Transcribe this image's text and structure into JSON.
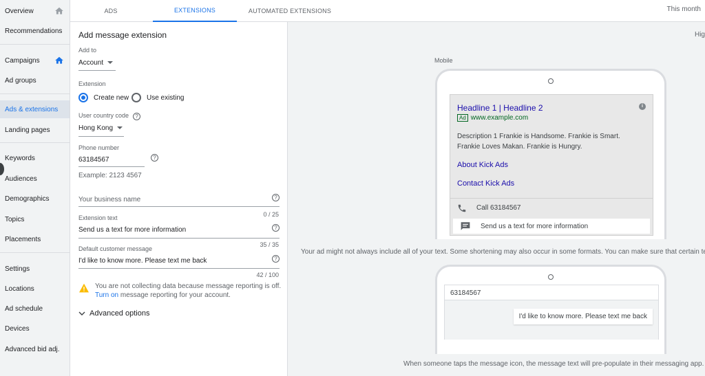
{
  "sidebar": {
    "items": [
      {
        "label": "Overview"
      },
      {
        "label": "Recommendations"
      },
      {
        "label": "Campaigns"
      },
      {
        "label": "Ad groups"
      },
      {
        "label": "Ads & extensions"
      },
      {
        "label": "Landing pages"
      },
      {
        "label": "Keywords"
      },
      {
        "label": "Audiences"
      },
      {
        "label": "Demographics"
      },
      {
        "label": "Topics"
      },
      {
        "label": "Placements"
      },
      {
        "label": "Settings"
      },
      {
        "label": "Locations"
      },
      {
        "label": "Ad schedule"
      },
      {
        "label": "Devices"
      },
      {
        "label": "Advanced bid adj."
      }
    ],
    "active_index": 4
  },
  "tabs": [
    {
      "label": "ADS"
    },
    {
      "label": "EXTENSIONS"
    },
    {
      "label": "AUTOMATED EXTENSIONS"
    }
  ],
  "date_range": "This month",
  "form": {
    "title": "Add message extension",
    "add_to_label": "Add to",
    "add_to_value": "Account",
    "extension_label": "Extension",
    "radio_create": "Create new",
    "radio_existing": "Use existing",
    "country_label": "User country code",
    "country_value": "Hong Kong",
    "phone_label": "Phone number",
    "phone_value": "63184567",
    "phone_example": "Example: 2123 4567",
    "business_placeholder": "Your business name",
    "business_counter": "0 / 25",
    "ext_text_label": "Extension text",
    "ext_text_value": "Send us a text for more information",
    "ext_text_counter": "35 / 35",
    "default_msg_label": "Default customer message",
    "default_msg_value": "I'd like to know more. Please text me back",
    "default_msg_counter": "42 / 100",
    "warning_line1": "You are not collecting data because message reporting is off.",
    "warning_link": "Turn on",
    "warning_line2": "message reporting for your account.",
    "advanced_label": "Advanced options",
    "help_glyph": "?"
  },
  "preview": {
    "corner_text": "Hig",
    "mobile_label": "Mobile",
    "ad": {
      "headline": "Headline 1 | Headline 2",
      "badge": "Ad",
      "url": "www.example.com",
      "description": "Description 1 Frankie is Handsome. Frankie is Smart. Frankie Loves Makan. Frankie is Hungry.",
      "link1": "About Kick Ads",
      "link2": "Contact Kick Ads",
      "call_text": "Call 63184567",
      "message_text": "Send us a text for more information",
      "info_glyph": "i"
    },
    "disclaimer": "Your ad might not always include all of your text. Some shortening may also occur in some formats. You can make sure that certain text",
    "message_phone_number": "63184567",
    "message_bubble": "I'd like to know more. Please text me back",
    "footer_note": "When someone taps the message icon, the message text will pre-populate in their messaging app."
  },
  "colors": {
    "accent": "#1a73e8",
    "warning": "#fbbc04",
    "ad_link": "#1a0dab",
    "ad_url": "#006621"
  }
}
